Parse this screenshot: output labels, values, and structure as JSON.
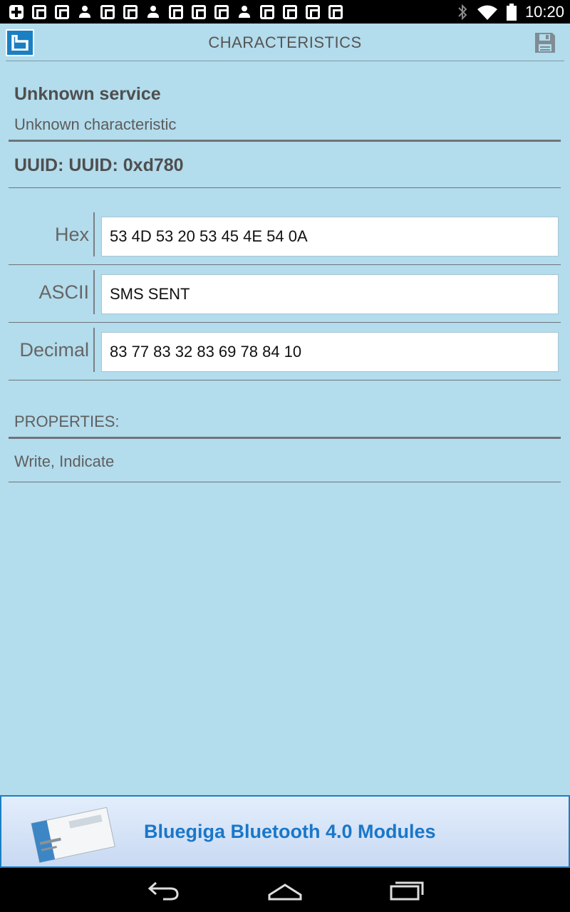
{
  "status_bar": {
    "time": "10:20",
    "icons": [
      "plus-icon",
      "notification-icon",
      "notification-icon",
      "person-icon",
      "notification-icon",
      "notification-icon",
      "person-icon",
      "notification-icon",
      "notification-icon",
      "notification-icon",
      "person-icon",
      "notification-icon",
      "notification-icon",
      "notification-icon",
      "notification-icon",
      "bluetooth-icon",
      "wifi-icon",
      "battery-icon"
    ]
  },
  "action_bar": {
    "title": "CHARACTERISTICS"
  },
  "service": {
    "name": "Unknown service",
    "characteristic": "Unknown characteristic",
    "uuid": "UUID: UUID: 0xd780"
  },
  "values": {
    "hex": {
      "label": "Hex",
      "value": "53 4D 53 20 53 45 4E 54 0A"
    },
    "ascii": {
      "label": "ASCII",
      "value": "SMS SENT"
    },
    "decimal": {
      "label": "Decimal",
      "value": "83 77 83 32 83 69 78 84 10"
    }
  },
  "properties": {
    "label": "PROPERTIES:",
    "value": "Write, Indicate"
  },
  "ad_banner": {
    "text": "Bluegiga Bluetooth 4.0 Modules"
  },
  "colors": {
    "background": "#b3dcec",
    "accent": "#1980c4",
    "ad_text": "#1a77c9"
  }
}
